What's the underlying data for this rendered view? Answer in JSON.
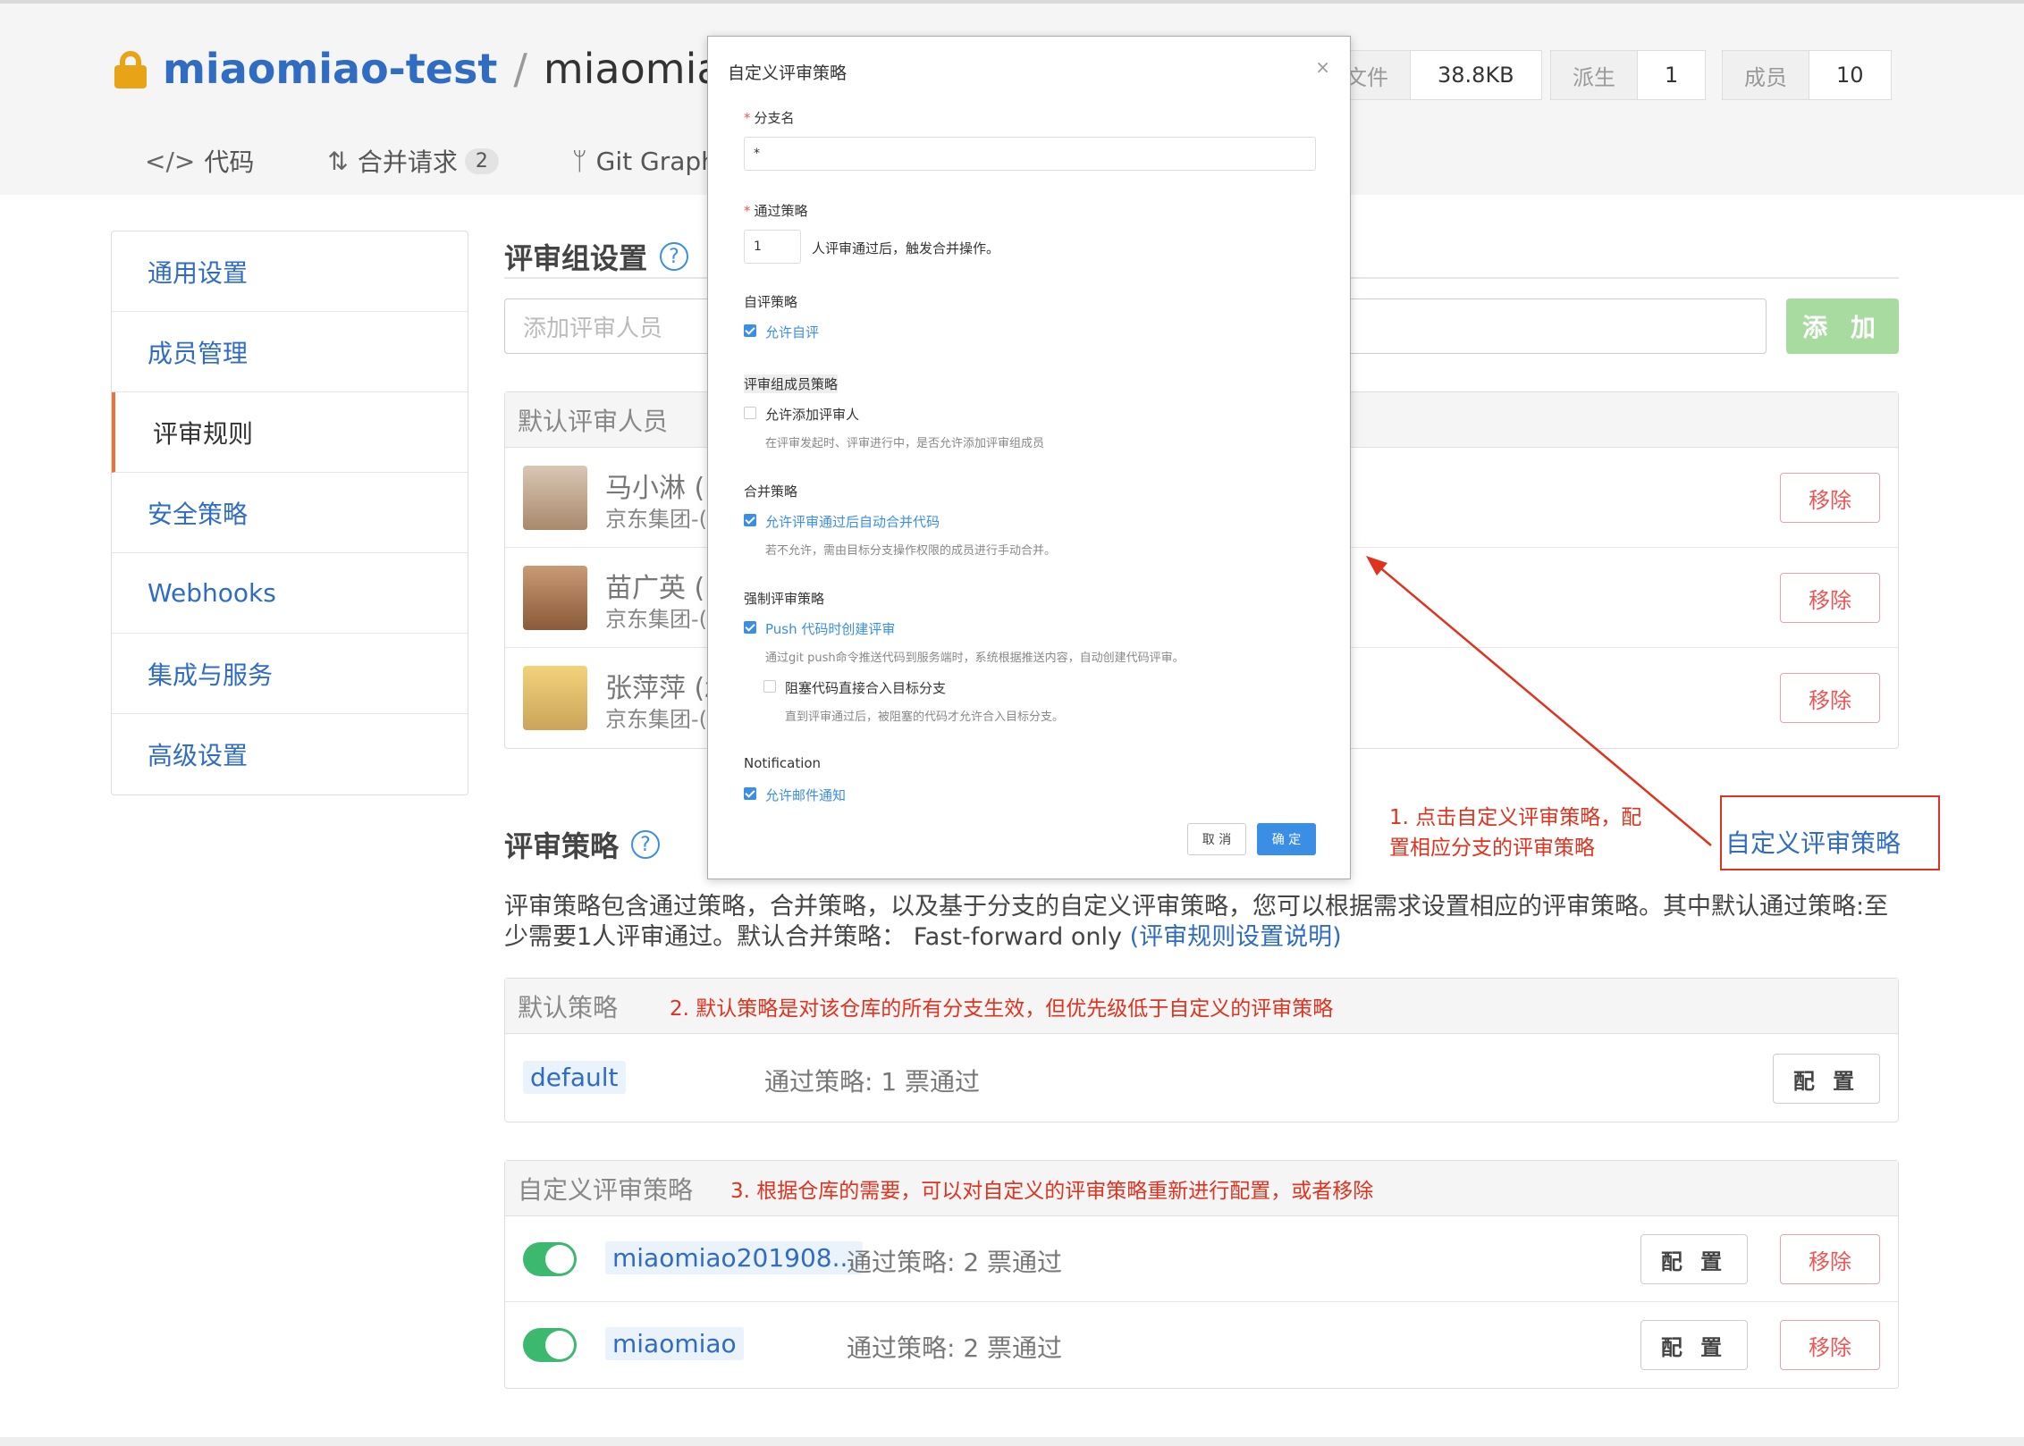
{
  "repo": {
    "owner": "miaomiao-test",
    "separator": "/",
    "name": "miaomiao2("
  },
  "tabs": [
    {
      "label": "代码",
      "icon": "</>"
    },
    {
      "label": "合并请求",
      "count": "2",
      "icon": "⇅"
    },
    {
      "label": "Git Graph",
      "icon": "ᛘ"
    }
  ],
  "stats": [
    {
      "key": "文件",
      "value": "38.8KB"
    },
    {
      "key": "派生",
      "value": "1"
    },
    {
      "key": "成员",
      "value": "10"
    }
  ],
  "sidebar": {
    "items": [
      {
        "label": "通用设置"
      },
      {
        "label": "成员管理"
      },
      {
        "label": "评审规则"
      },
      {
        "label": "安全策略"
      },
      {
        "label": "Webhooks"
      },
      {
        "label": "集成与服务"
      },
      {
        "label": "高级设置"
      }
    ]
  },
  "review_group": {
    "title": "评审组设置",
    "help": "?",
    "input_placeholder": "添加评审人员",
    "add_button": "添 加",
    "default_reviewers_header": "默认评审人员",
    "reviewers": [
      {
        "name": "马小淋 (n",
        "org": "京东集团-(",
        "remove": "移除"
      },
      {
        "name": "苗广英 (n",
        "org": "京东集团-(",
        "remove": "移除"
      },
      {
        "name": "张萍萍 (z",
        "org": "京东集团-(",
        "remove": "移除"
      }
    ]
  },
  "review_policy": {
    "title": "评审策略",
    "help": "?",
    "description": "评审策略包含通过策略，合并策略，以及基于分支的自定义评审策略，您可以根据需求设置相应的评审策略。其中默认通过策略:至少需要1人评审通过。默认合并策略： Fast-forward only ",
    "description_link": "(评审规则设置说明)",
    "default_header": "默认策略",
    "default_note": "2. 默认策略是对该仓库的所有分支生效，但优先级低于自定义的评审策略",
    "default_branch": "default",
    "default_pass": "通过策略: 1 票通过",
    "config_label": "配 置",
    "custom_header": "自定义评审策略",
    "custom_note": "3. 根据仓库的需要，可以对自定义的评审策略重新进行配置，或者移除",
    "custom": [
      {
        "branch": "miaomiao201908...",
        "pass": "通过策略: 2 票通过",
        "config": "配 置",
        "remove": "移除",
        "enabled": true
      },
      {
        "branch": "miaomiao",
        "pass": "通过策略: 2 票通过",
        "config": "配 置",
        "remove": "移除",
        "enabled": true
      }
    ]
  },
  "modal": {
    "title": "自定义评审策略",
    "close": "×",
    "branch_label": "分支名",
    "branch_value": "*",
    "pass_label": "通过策略",
    "pass_value": "1",
    "pass_suffix": "人评审通过后，触发合并操作。",
    "self_review_label": "自评策略",
    "self_review_opt": "允许自评",
    "group_label": "评审组成员策略",
    "group_opt": "允许添加评审人",
    "group_help": "在评审发起时、评审进行中，是否允许添加评审组成员",
    "merge_label": "合并策略",
    "merge_opt": "允许评审通过后自动合并代码",
    "merge_help": "若不允许，需由目标分支操作权限的成员进行手动合并。",
    "force_label": "强制评审策略",
    "force_opt": "Push 代码时创建评审",
    "force_help": "通过git push命令推送代码到服务端时，系统根据推送内容，自动创建代码评审。",
    "block_opt": "阻塞代码直接合入目标分支",
    "block_help": "直到评审通过后，被阻塞的代码才允许合入目标分支。",
    "notify_label": "Notification",
    "notify_opt": "允许邮件通知",
    "cancel": "取 消",
    "ok": "确 定"
  },
  "annotations": {
    "note1_line1": "1. 点击自定义评审策略，配",
    "note1_line2": "置相应分支的评审策略",
    "callout": "自定义评审策略"
  },
  "colors": {
    "accent": "#2f6cc2",
    "danger": "#e0321e",
    "success": "#3cb96e",
    "primary": "#3a8ee6"
  }
}
